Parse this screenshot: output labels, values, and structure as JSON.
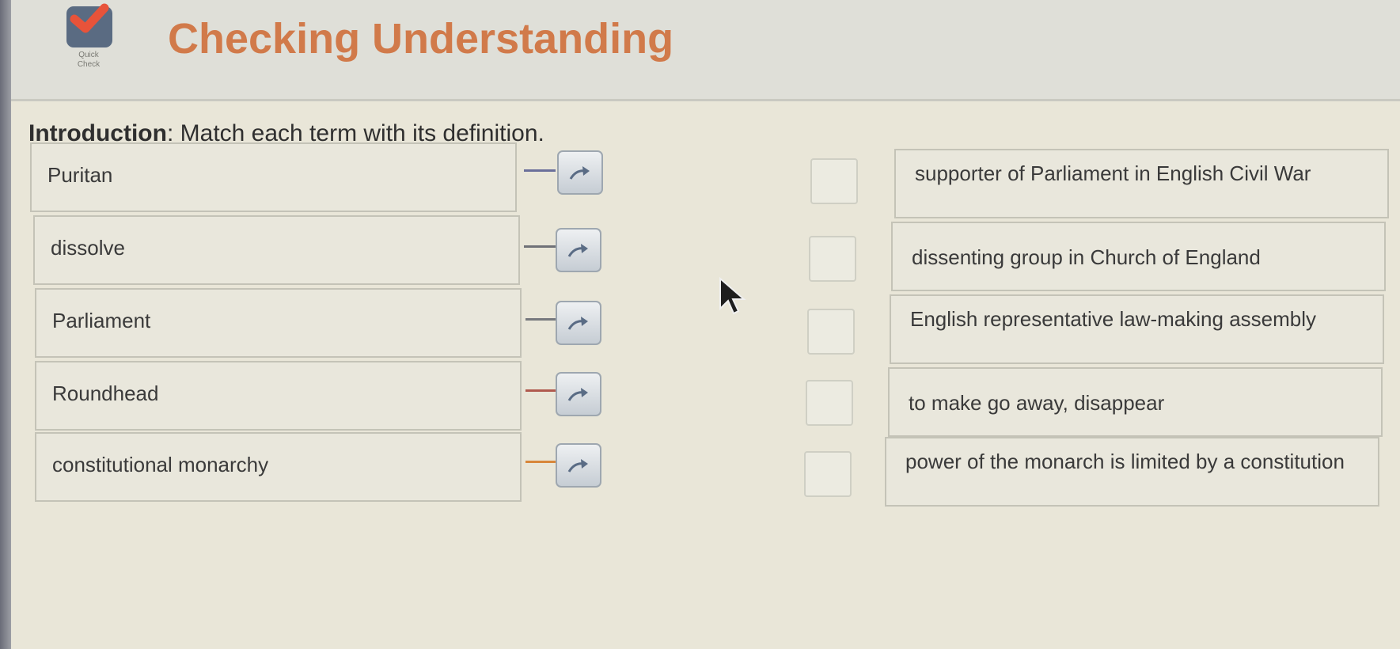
{
  "header": {
    "title": "Checking Understanding",
    "logo_text_line1": "Quick",
    "logo_text_line2": "Check"
  },
  "instructions": {
    "label": "Introduction",
    "text": ": Match each term with its definition."
  },
  "terms": [
    {
      "label": "Puritan",
      "connector_color": "#6a6f9a"
    },
    {
      "label": "dissolve",
      "connector_color": "#6f7177"
    },
    {
      "label": "Parliament",
      "connector_color": "#76787d"
    },
    {
      "label": "Roundhead",
      "connector_color": "#b05a4e"
    },
    {
      "label": "constitutional monarchy",
      "connector_color": "#d8873a"
    }
  ],
  "definitions": [
    {
      "text": "supporter of Parliament in English Civil War"
    },
    {
      "text": "dissenting group in Church of England"
    },
    {
      "text": "English representative law-making assembly"
    },
    {
      "text": "to make go away, disappear"
    },
    {
      "text": "power of the monarch is limited by a constitution"
    }
  ],
  "icons": {
    "logo": "checkmark-icon",
    "match_button": "curved-arrow-icon",
    "cursor": "mouse-pointer-icon"
  },
  "colors": {
    "title": "#d17a4a",
    "logo_check": "#e8533a",
    "logo_badge": "#5a6b82"
  }
}
